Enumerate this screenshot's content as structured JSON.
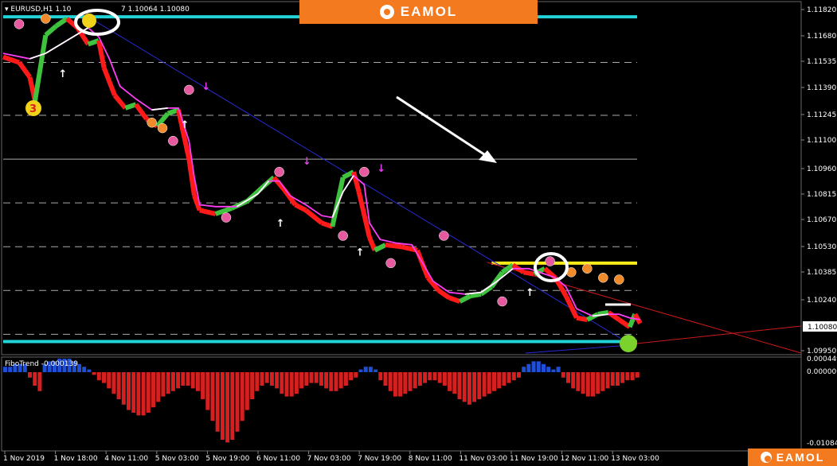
{
  "symbol_label": "EURUSD,H1  1.10",
  "ohlc_tail": "7 1.10064 1.10080",
  "indicator_label": "FiboTrend -0.000139",
  "brand": {
    "text": "EAMOL",
    "color": "#f47a20"
  },
  "chart_data": [
    {
      "type": "line",
      "title": "EURUSD,H1",
      "xlabel": "",
      "ylabel": "",
      "x_ticks": [
        "1 Nov 2019",
        "1 Nov 18:00",
        "4 Nov 11:00",
        "5 Nov 03:00",
        "5 Nov 19:00",
        "6 Nov 11:00",
        "7 Nov 03:00",
        "7 Nov 19:00",
        "8 Nov 11:00",
        "11 Nov 03:00",
        "11 Nov 19:00",
        "12 Nov 11:00",
        "13 Nov 03:00"
      ],
      "y_ticks": [
        "1.11820",
        "1.11680",
        "1.11535",
        "1.11390",
        "1.11245",
        "1.11100",
        "1.10960",
        "1.10815",
        "1.10670",
        "1.10530",
        "1.10385",
        "1.10240",
        "1.10080",
        "1.09950"
      ],
      "ylim": [
        1.0995,
        1.1182
      ],
      "current_price": "1.10080",
      "price_path": [
        [
          0,
          1.1156
        ],
        [
          3,
          1.1153
        ],
        [
          5,
          1.1145
        ],
        [
          6,
          1.1132
        ],
        [
          8,
          1.1168
        ],
        [
          10,
          1.1173
        ],
        [
          12,
          1.1177
        ],
        [
          14,
          1.1172
        ],
        [
          16,
          1.1163
        ],
        [
          18,
          1.1165
        ],
        [
          19,
          1.115
        ],
        [
          21,
          1.1135
        ],
        [
          23,
          1.1128
        ],
        [
          25,
          1.113
        ],
        [
          27,
          1.1122
        ],
        [
          29,
          1.1118
        ],
        [
          31,
          1.1125
        ],
        [
          33,
          1.1127
        ],
        [
          35,
          1.11
        ],
        [
          36,
          1.108
        ],
        [
          37,
          1.1072
        ],
        [
          40,
          1.107
        ],
        [
          43,
          1.1073
        ],
        [
          46,
          1.1077
        ],
        [
          49,
          1.1085
        ],
        [
          51,
          1.109
        ],
        [
          53,
          1.1083
        ],
        [
          55,
          1.1075
        ],
        [
          57,
          1.1072
        ],
        [
          60,
          1.1065
        ],
        [
          62,
          1.1063
        ],
        [
          64,
          1.109
        ],
        [
          66,
          1.1093
        ],
        [
          67,
          1.1082
        ],
        [
          69,
          1.1057
        ],
        [
          70,
          1.105
        ],
        [
          72,
          1.1053
        ],
        [
          75,
          1.1052
        ],
        [
          78,
          1.105
        ],
        [
          80,
          1.1035
        ],
        [
          82,
          1.1028
        ],
        [
          84,
          1.1024
        ],
        [
          86,
          1.1022
        ],
        [
          88,
          1.1025
        ],
        [
          90,
          1.1026
        ],
        [
          92,
          1.103
        ],
        [
          94,
          1.1038
        ],
        [
          96,
          1.1042
        ],
        [
          98,
          1.1038
        ],
        [
          100,
          1.1037
        ],
        [
          102,
          1.104
        ],
        [
          104,
          1.1035
        ],
        [
          106,
          1.1025
        ],
        [
          108,
          1.1013
        ],
        [
          110,
          1.1012
        ],
        [
          112,
          1.1015
        ],
        [
          114,
          1.1016
        ],
        [
          116,
          1.1012
        ],
        [
          118,
          1.1008
        ],
        [
          119,
          1.1015
        ],
        [
          120,
          1.101
        ]
      ],
      "trend_path": [
        [
          0,
          1.1158
        ],
        [
          5,
          1.1155
        ],
        [
          8,
          1.1158
        ],
        [
          12,
          1.1165
        ],
        [
          16,
          1.1172
        ],
        [
          18,
          1.1167
        ],
        [
          20,
          1.1155
        ],
        [
          22,
          1.114
        ],
        [
          25,
          1.1133
        ],
        [
          28,
          1.1127
        ],
        [
          31,
          1.1128
        ],
        [
          33,
          1.1128
        ],
        [
          35,
          1.111
        ],
        [
          36,
          1.109
        ],
        [
          37,
          1.1075
        ],
        [
          40,
          1.1074
        ],
        [
          44,
          1.1074
        ],
        [
          48,
          1.1081
        ],
        [
          50,
          1.1088
        ],
        [
          52,
          1.1088
        ],
        [
          54,
          1.108
        ],
        [
          57,
          1.1075
        ],
        [
          60,
          1.1069
        ],
        [
          62,
          1.1068
        ],
        [
          64,
          1.1082
        ],
        [
          66,
          1.1091
        ],
        [
          68,
          1.1086
        ],
        [
          69,
          1.1065
        ],
        [
          71,
          1.1056
        ],
        [
          74,
          1.1054
        ],
        [
          77,
          1.1053
        ],
        [
          79,
          1.1043
        ],
        [
          81,
          1.1033
        ],
        [
          84,
          1.1027
        ],
        [
          87,
          1.1026
        ],
        [
          90,
          1.1027
        ],
        [
          93,
          1.1033
        ],
        [
          96,
          1.104
        ],
        [
          99,
          1.104
        ],
        [
          102,
          1.1037
        ],
        [
          104,
          1.1035
        ],
        [
          106,
          1.103
        ],
        [
          108,
          1.1018
        ],
        [
          111,
          1.1014
        ],
        [
          114,
          1.1015
        ],
        [
          116,
          1.1015
        ],
        [
          118,
          1.1013
        ],
        [
          120,
          1.1012
        ]
      ],
      "horizontal_levels": [
        {
          "value": 1.1178,
          "color": "#22d3d8",
          "style": "solid-thick"
        },
        {
          "value": 1.1153,
          "color": "#aaaaaa",
          "style": "dashed"
        },
        {
          "value": 1.1124,
          "color": "#aaaaaa",
          "style": "dashed"
        },
        {
          "value": 1.11,
          "color": "#aaaaaa",
          "style": "solid"
        },
        {
          "value": 1.1076,
          "color": "#aaaaaa",
          "style": "dashed"
        },
        {
          "value": 1.1052,
          "color": "#aaaaaa",
          "style": "dashed"
        },
        {
          "value": 1.1028,
          "color": "#aaaaaa",
          "style": "dashed"
        },
        {
          "value": 1.1004,
          "color": "#aaaaaa",
          "style": "dashed"
        },
        {
          "value": 1.1,
          "color": "#22d3d8",
          "style": "solid-thick"
        },
        {
          "value": 1.1043,
          "color": "#ffeb1a",
          "style": "solid-thick",
          "from": 92,
          "to": 130
        }
      ],
      "colors": {
        "bull": "#3fc33f",
        "bear": "#ff1a1a",
        "trend": "#ff3df5",
        "trend_bull": "#ffffff",
        "support": "#22d3d8",
        "resistance": "#ffeb1a",
        "downtrend": "#2a2ad6",
        "channel_red": "#cc1a1a"
      }
    },
    {
      "type": "bar",
      "title": "FiboTrend",
      "current_value": -0.000139,
      "y_ticks": [
        "0.000449",
        "0.000000",
        "-0.01084"
      ],
      "values": [
        2,
        2,
        3,
        3,
        3,
        -2,
        -5,
        -7,
        3,
        4,
        4,
        5,
        5,
        5,
        4,
        3,
        2,
        1,
        -1,
        -3,
        -4,
        -6,
        -8,
        -10,
        -12,
        -14,
        -15,
        -16,
        -16,
        -15,
        -13,
        -11,
        -9,
        -8,
        -7,
        -6,
        -5,
        -5,
        -6,
        -7,
        -10,
        -14,
        -18,
        -22,
        -25,
        -26,
        -25,
        -22,
        -18,
        -14,
        -10,
        -7,
        -5,
        -4,
        -5,
        -6,
        -8,
        -9,
        -9,
        -8,
        -6,
        -5,
        -4,
        -4,
        -5,
        -6,
        -7,
        -7,
        -6,
        -5,
        -3,
        -2,
        1,
        2,
        2,
        1,
        -3,
        -5,
        -7,
        -9,
        -9,
        -8,
        -7,
        -6,
        -5,
        -4,
        -3,
        -3,
        -4,
        -5,
        -7,
        -8,
        -10,
        -11,
        -12,
        -11,
        -10,
        -9,
        -8,
        -7,
        -6,
        -5,
        -4,
        -3,
        -2,
        2,
        3,
        4,
        4,
        3,
        2,
        1,
        2,
        -2,
        -4,
        -6,
        -7,
        -8,
        -9,
        -9,
        -8,
        -7,
        -6,
        -5,
        -5,
        -4,
        -3,
        -3,
        -2
      ],
      "colors": {
        "positive": "#1f4fd6",
        "negative": "#d61f1f"
      }
    }
  ]
}
